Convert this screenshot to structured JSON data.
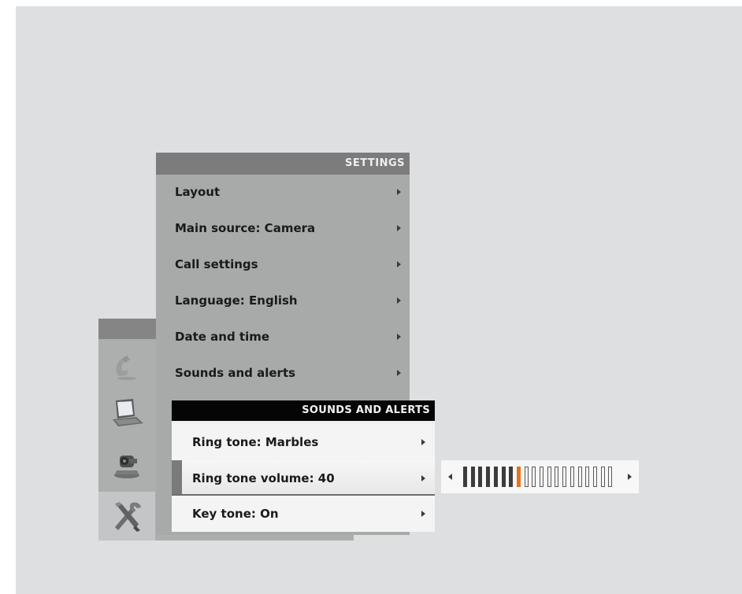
{
  "settings": {
    "header": "SETTINGS",
    "items": [
      {
        "label": "Layout"
      },
      {
        "label": "Main source: Camera"
      },
      {
        "label": "Call settings"
      },
      {
        "label": "Language: English"
      },
      {
        "label": "Date and time"
      },
      {
        "label": "Sounds and alerts"
      }
    ]
  },
  "sounds_and_alerts": {
    "header": "SOUNDS AND ALERTS",
    "items": [
      {
        "label": "Ring tone: Marbles"
      },
      {
        "label": "Ring tone volume: 40",
        "selected": true
      },
      {
        "label": "Key tone: On"
      }
    ]
  },
  "ring_tone_volume_slider": {
    "value": 40,
    "total_steps": 20,
    "filled_steps": 8,
    "marker_color": "#e8721c",
    "filled_color": "#3c3c3c"
  },
  "rail": {
    "icons": [
      "phone-icon",
      "laptop-icon",
      "camera-icon",
      "tools-icon"
    ],
    "active": "tools-icon"
  }
}
